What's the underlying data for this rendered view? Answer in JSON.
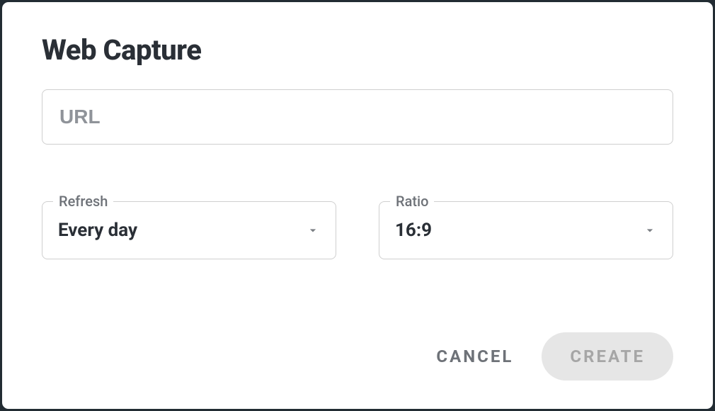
{
  "dialog": {
    "title": "Web Capture",
    "url_placeholder": "URL",
    "url_value": "",
    "refresh": {
      "label": "Refresh",
      "value": "Every day"
    },
    "ratio": {
      "label": "Ratio",
      "value": "16:9"
    },
    "cancel_label": "CANCEL",
    "create_label": "CREATE"
  }
}
